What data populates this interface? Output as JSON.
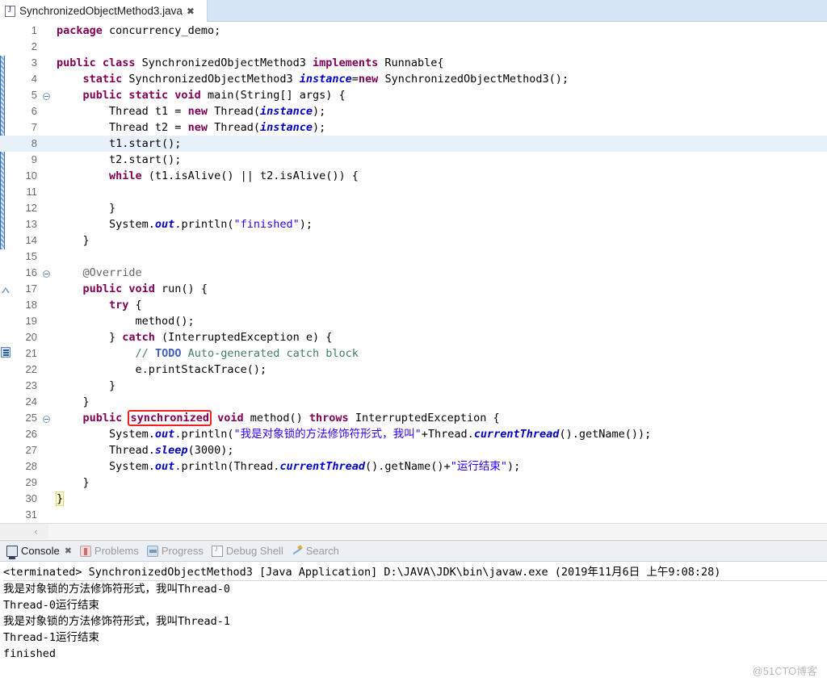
{
  "editor_tab": {
    "filename": "SynchronizedObjectMethod3.java",
    "icon": "java-file-icon",
    "close_label": "✖"
  },
  "code": {
    "highlighted_line": 8,
    "lines": [
      {
        "n": 1,
        "marker": "",
        "tokens": [
          {
            "t": "kw",
            "v": "package"
          },
          {
            "t": "pln",
            "v": " concurrency_demo;"
          }
        ]
      },
      {
        "n": 2,
        "marker": "",
        "tokens": []
      },
      {
        "n": 3,
        "marker": "",
        "tokens": [
          {
            "t": "kw",
            "v": "public "
          },
          {
            "t": "kw",
            "v": "class"
          },
          {
            "t": "pln",
            "v": " SynchronizedObjectMethod3 "
          },
          {
            "t": "kw",
            "v": "implements"
          },
          {
            "t": "pln",
            "v": " Runnable{"
          }
        ]
      },
      {
        "n": 4,
        "marker": "",
        "tokens": [
          {
            "t": "pln",
            "v": "    "
          },
          {
            "t": "kw",
            "v": "static"
          },
          {
            "t": "pln",
            "v": " SynchronizedObjectMethod3 "
          },
          {
            "t": "fld",
            "v": "instance"
          },
          {
            "t": "pln",
            "v": "="
          },
          {
            "t": "kw",
            "v": "new"
          },
          {
            "t": "pln",
            "v": " SynchronizedObjectMethod3();"
          }
        ]
      },
      {
        "n": 5,
        "marker": "fold",
        "tokens": [
          {
            "t": "pln",
            "v": "    "
          },
          {
            "t": "kw",
            "v": "public static void"
          },
          {
            "t": "pln",
            "v": " main(String[] args) {"
          }
        ]
      },
      {
        "n": 6,
        "marker": "",
        "tokens": [
          {
            "t": "pln",
            "v": "        Thread t1 = "
          },
          {
            "t": "kw",
            "v": "new"
          },
          {
            "t": "pln",
            "v": " Thread("
          },
          {
            "t": "fld",
            "v": "instance"
          },
          {
            "t": "pln",
            "v": ");"
          }
        ]
      },
      {
        "n": 7,
        "marker": "",
        "tokens": [
          {
            "t": "pln",
            "v": "        Thread t2 = "
          },
          {
            "t": "kw",
            "v": "new"
          },
          {
            "t": "pln",
            "v": " Thread("
          },
          {
            "t": "fld",
            "v": "instance"
          },
          {
            "t": "pln",
            "v": ");"
          }
        ]
      },
      {
        "n": 8,
        "marker": "",
        "tokens": [
          {
            "t": "pln",
            "v": "        t1.start();"
          }
        ]
      },
      {
        "n": 9,
        "marker": "",
        "tokens": [
          {
            "t": "pln",
            "v": "        t2.start();"
          }
        ]
      },
      {
        "n": 10,
        "marker": "",
        "tokens": [
          {
            "t": "pln",
            "v": "        "
          },
          {
            "t": "kw",
            "v": "while"
          },
          {
            "t": "pln",
            "v": " (t1.isAlive() || t2.isAlive()) {"
          }
        ]
      },
      {
        "n": 11,
        "marker": "",
        "tokens": []
      },
      {
        "n": 12,
        "marker": "",
        "tokens": [
          {
            "t": "pln",
            "v": "        }"
          }
        ]
      },
      {
        "n": 13,
        "marker": "",
        "tokens": [
          {
            "t": "pln",
            "v": "        System."
          },
          {
            "t": "fld",
            "v": "out"
          },
          {
            "t": "pln",
            "v": ".println("
          },
          {
            "t": "str",
            "v": "\"finished\""
          },
          {
            "t": "pln",
            "v": ");"
          }
        ]
      },
      {
        "n": 14,
        "marker": "",
        "tokens": [
          {
            "t": "pln",
            "v": "    }"
          }
        ]
      },
      {
        "n": 15,
        "marker": "",
        "tokens": []
      },
      {
        "n": 16,
        "marker": "fold",
        "tokens": [
          {
            "t": "pln",
            "v": "    "
          },
          {
            "t": "ann",
            "v": "@Override"
          }
        ]
      },
      {
        "n": 17,
        "marker": "override",
        "tokens": [
          {
            "t": "pln",
            "v": "    "
          },
          {
            "t": "kw",
            "v": "public void"
          },
          {
            "t": "pln",
            "v": " run() {"
          }
        ]
      },
      {
        "n": 18,
        "marker": "",
        "tokens": [
          {
            "t": "pln",
            "v": "        "
          },
          {
            "t": "kw",
            "v": "try"
          },
          {
            "t": "pln",
            "v": " {"
          }
        ]
      },
      {
        "n": 19,
        "marker": "",
        "tokens": [
          {
            "t": "pln",
            "v": "            method();"
          }
        ]
      },
      {
        "n": 20,
        "marker": "",
        "tokens": [
          {
            "t": "pln",
            "v": "        } "
          },
          {
            "t": "kw",
            "v": "catch"
          },
          {
            "t": "pln",
            "v": " (InterruptedException e) {"
          }
        ]
      },
      {
        "n": 21,
        "marker": "todo",
        "tokens": [
          {
            "t": "pln",
            "v": "            "
          },
          {
            "t": "cmt",
            "v": "// "
          },
          {
            "t": "todo",
            "v": "TODO"
          },
          {
            "t": "cmt",
            "v": " Auto-generated catch block"
          }
        ]
      },
      {
        "n": 22,
        "marker": "",
        "tokens": [
          {
            "t": "pln",
            "v": "            e.printStackTrace();"
          }
        ]
      },
      {
        "n": 23,
        "marker": "",
        "tokens": [
          {
            "t": "pln",
            "v": "        }"
          }
        ]
      },
      {
        "n": 24,
        "marker": "",
        "tokens": [
          {
            "t": "pln",
            "v": "    }"
          }
        ]
      },
      {
        "n": 25,
        "marker": "fold",
        "tokens": [
          {
            "t": "pln",
            "v": "    "
          },
          {
            "t": "kw",
            "v": "public"
          },
          {
            "t": "pln",
            "v": " "
          },
          {
            "t": "kw boxed",
            "v": "synchronized"
          },
          {
            "t": "pln",
            "v": " "
          },
          {
            "t": "kw",
            "v": "void"
          },
          {
            "t": "pln",
            "v": " method() "
          },
          {
            "t": "kw",
            "v": "throws"
          },
          {
            "t": "pln",
            "v": " InterruptedException {"
          }
        ]
      },
      {
        "n": 26,
        "marker": "",
        "tokens": [
          {
            "t": "pln",
            "v": "        System."
          },
          {
            "t": "fld",
            "v": "out"
          },
          {
            "t": "pln",
            "v": ".println("
          },
          {
            "t": "str",
            "v": "\"我是对象锁的方法修饰符形式，我叫\""
          },
          {
            "t": "pln",
            "v": "+Thread."
          },
          {
            "t": "fld",
            "v": "currentThread"
          },
          {
            "t": "pln",
            "v": "().getName());"
          }
        ]
      },
      {
        "n": 27,
        "marker": "",
        "tokens": [
          {
            "t": "pln",
            "v": "        Thread."
          },
          {
            "t": "fld",
            "v": "sleep"
          },
          {
            "t": "pln",
            "v": "(3000);"
          }
        ]
      },
      {
        "n": 28,
        "marker": "",
        "tokens": [
          {
            "t": "pln",
            "v": "        System."
          },
          {
            "t": "fld",
            "v": "out"
          },
          {
            "t": "pln",
            "v": ".println(Thread."
          },
          {
            "t": "fld",
            "v": "currentThread"
          },
          {
            "t": "pln",
            "v": "().getName()+"
          },
          {
            "t": "str",
            "v": "\"运行结束\""
          },
          {
            "t": "pln",
            "v": ");"
          }
        ]
      },
      {
        "n": 29,
        "marker": "",
        "tokens": [
          {
            "t": "pln",
            "v": "    }"
          }
        ]
      },
      {
        "n": 30,
        "marker": "",
        "tokens": [
          {
            "t": "pln brace-match",
            "v": "}"
          }
        ]
      },
      {
        "n": 31,
        "marker": "",
        "tokens": []
      }
    ]
  },
  "scrollbar": {
    "left_arrow": "‹"
  },
  "console": {
    "tabs": [
      {
        "label": "Console",
        "icon": "console-icon",
        "active": true,
        "closable": true
      },
      {
        "label": "Problems",
        "icon": "problems-icon",
        "active": false,
        "closable": false
      },
      {
        "label": "Progress",
        "icon": "progress-icon",
        "active": false,
        "closable": false
      },
      {
        "label": "Debug Shell",
        "icon": "debug-shell-icon",
        "active": false,
        "closable": false
      },
      {
        "label": "Search",
        "icon": "search-icon",
        "active": false,
        "closable": false
      }
    ],
    "close_glyph": "✖",
    "header": "<terminated> SynchronizedObjectMethod3 [Java Application] D:\\JAVA\\JDK\\bin\\javaw.exe (2019年11月6日 上午9:08:28)",
    "output": [
      "我是对象锁的方法修饰符形式，我叫Thread-0",
      "Thread-0运行结束",
      "我是对象锁的方法修饰符形式，我叫Thread-1",
      "Thread-1运行结束",
      "finished"
    ]
  },
  "watermark": {
    "text": "@51CTO博客"
  },
  "colors": {
    "keyword": "#7f0055",
    "string": "#2a00ff",
    "comment": "#3f7f5f",
    "todo": "#3f5fbf",
    "field": "#0000c0",
    "highlight_box": "#ef2222",
    "current_line": "#e8f0fa",
    "tabbar": "#d6e5f5"
  }
}
